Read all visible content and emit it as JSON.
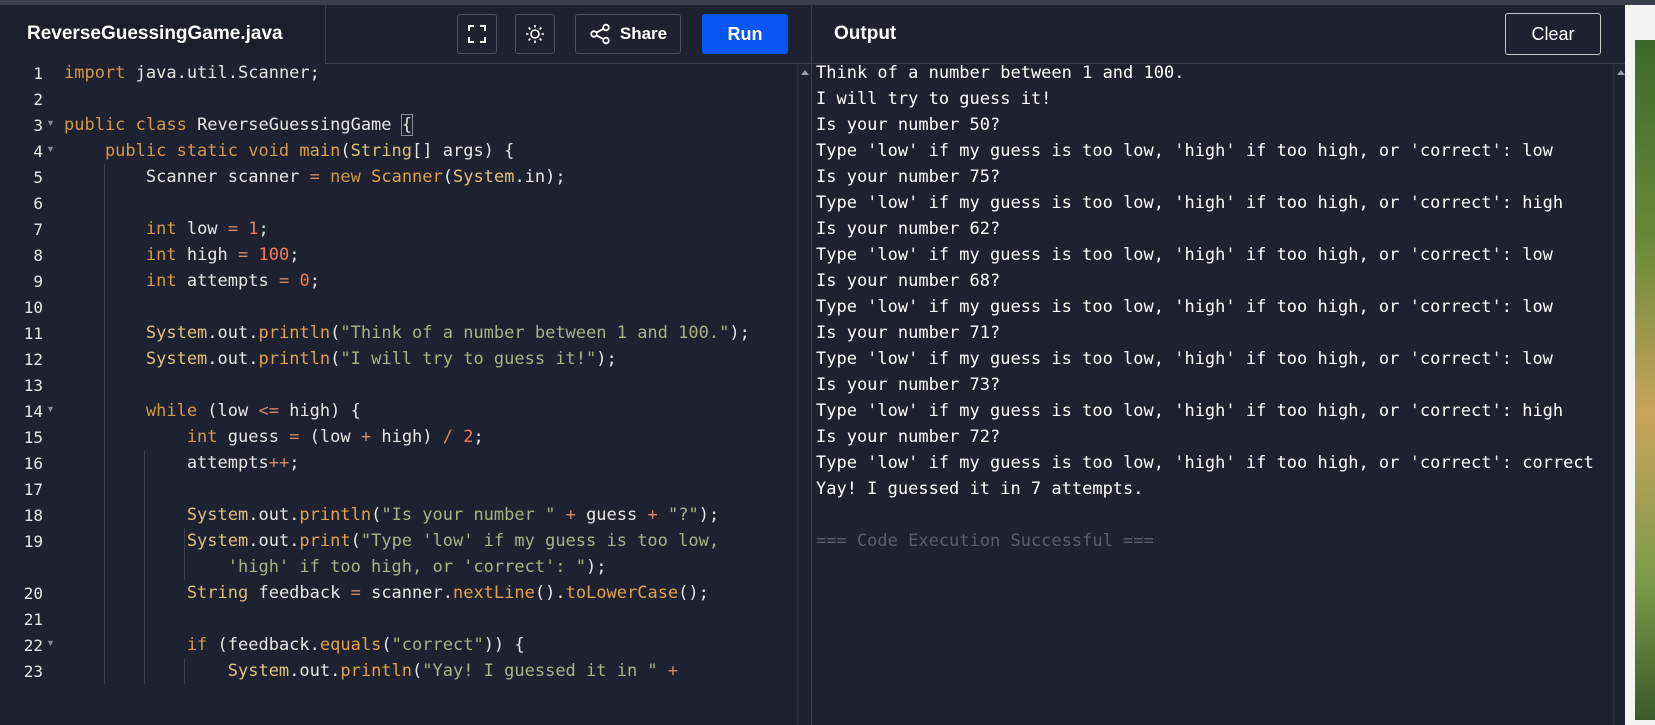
{
  "file_tab": {
    "name": "ReverseGuessingGame.java"
  },
  "toolbar": {
    "fullscreen_icon": "fullscreen-icon",
    "theme_icon": "sun-icon",
    "share_icon": "share-icon",
    "share_label": "Share",
    "run_label": "Run",
    "run_color": "#0556f3"
  },
  "output_panel": {
    "title": "Output",
    "clear_label": "Clear",
    "lines": [
      "Think of a number between 1 and 100.",
      "I will try to guess it!",
      "Is your number 50?",
      "Type 'low' if my guess is too low, 'high' if too high, or 'correct': low",
      "Is your number 75?",
      "Type 'low' if my guess is too low, 'high' if too high, or 'correct': high",
      "Is your number 62?",
      "Type 'low' if my guess is too low, 'high' if too high, or 'correct': low",
      "Is your number 68?",
      "Type 'low' if my guess is too low, 'high' if too high, or 'correct': low",
      "Is your number 71?",
      "Type 'low' if my guess is too low, 'high' if too high, or 'correct': low",
      "Is your number 73?",
      "Type 'low' if my guess is too low, 'high' if too high, or 'correct': high",
      "Is your number 72?",
      "Type 'low' if my guess is too low, 'high' if too high, or 'correct': correct",
      "Yay! I guessed it in 7 attempts."
    ],
    "status": "=== Code Execution Successful ==="
  },
  "editor": {
    "line_numbers": [
      "1",
      "2",
      "3",
      "4",
      "5",
      "6",
      "7",
      "8",
      "9",
      "10",
      "11",
      "12",
      "13",
      "14",
      "15",
      "16",
      "17",
      "18",
      "19",
      "",
      "20",
      "21",
      "22",
      "23"
    ],
    "lines": [
      [
        {
          "t": "import",
          "c": "kw"
        },
        {
          "t": " java.util.Scanner;",
          "c": ""
        }
      ],
      [],
      [
        {
          "t": "public class",
          "c": "kw"
        },
        {
          "t": " ReverseGuessingGame ",
          "c": ""
        },
        {
          "t": "{",
          "c": "bracket"
        }
      ],
      [
        {
          "t": "    public static void ",
          "c": "kw"
        },
        {
          "t": "main",
          "c": "fn"
        },
        {
          "t": "(",
          "c": ""
        },
        {
          "t": "String",
          "c": "ty"
        },
        {
          "t": "[] args) {",
          "c": ""
        }
      ],
      [
        {
          "t": "        Scanner scanner ",
          "c": ""
        },
        {
          "t": "=",
          "c": "op"
        },
        {
          "t": " ",
          "c": ""
        },
        {
          "t": "new",
          "c": "kw"
        },
        {
          "t": " ",
          "c": ""
        },
        {
          "t": "Scanner",
          "c": "fn"
        },
        {
          "t": "(",
          "c": ""
        },
        {
          "t": "System",
          "c": "cls"
        },
        {
          "t": ".in);",
          "c": ""
        }
      ],
      [],
      [
        {
          "t": "        int",
          "c": "kw"
        },
        {
          "t": " low ",
          "c": ""
        },
        {
          "t": "=",
          "c": "op"
        },
        {
          "t": " ",
          "c": ""
        },
        {
          "t": "1",
          "c": "num"
        },
        {
          "t": ";",
          "c": ""
        }
      ],
      [
        {
          "t": "        int",
          "c": "kw"
        },
        {
          "t": " high ",
          "c": ""
        },
        {
          "t": "=",
          "c": "op"
        },
        {
          "t": " ",
          "c": ""
        },
        {
          "t": "100",
          "c": "num"
        },
        {
          "t": ";",
          "c": ""
        }
      ],
      [
        {
          "t": "        int",
          "c": "kw"
        },
        {
          "t": " attempts ",
          "c": ""
        },
        {
          "t": "=",
          "c": "op"
        },
        {
          "t": " ",
          "c": ""
        },
        {
          "t": "0",
          "c": "num"
        },
        {
          "t": ";",
          "c": ""
        }
      ],
      [],
      [
        {
          "t": "        System",
          "c": "cls"
        },
        {
          "t": ".out.",
          "c": ""
        },
        {
          "t": "println",
          "c": "fn"
        },
        {
          "t": "(",
          "c": ""
        },
        {
          "t": "\"Think of a number between 1 and 100.\"",
          "c": "str"
        },
        {
          "t": ");",
          "c": ""
        }
      ],
      [
        {
          "t": "        System",
          "c": "cls"
        },
        {
          "t": ".out.",
          "c": ""
        },
        {
          "t": "println",
          "c": "fn"
        },
        {
          "t": "(",
          "c": ""
        },
        {
          "t": "\"I will try to guess it!\"",
          "c": "str"
        },
        {
          "t": ");",
          "c": ""
        }
      ],
      [],
      [
        {
          "t": "        while",
          "c": "kw"
        },
        {
          "t": " (low ",
          "c": ""
        },
        {
          "t": "<=",
          "c": "op"
        },
        {
          "t": " high) {",
          "c": ""
        }
      ],
      [
        {
          "t": "            int",
          "c": "kw"
        },
        {
          "t": " guess ",
          "c": ""
        },
        {
          "t": "=",
          "c": "op"
        },
        {
          "t": " (low ",
          "c": ""
        },
        {
          "t": "+",
          "c": "op"
        },
        {
          "t": " high) ",
          "c": ""
        },
        {
          "t": "/",
          "c": "op"
        },
        {
          "t": " ",
          "c": ""
        },
        {
          "t": "2",
          "c": "num"
        },
        {
          "t": ";",
          "c": ""
        }
      ],
      [
        {
          "t": "            attempts",
          "c": ""
        },
        {
          "t": "++",
          "c": "op"
        },
        {
          "t": ";",
          "c": ""
        }
      ],
      [],
      [
        {
          "t": "            System",
          "c": "cls"
        },
        {
          "t": ".out.",
          "c": ""
        },
        {
          "t": "println",
          "c": "fn"
        },
        {
          "t": "(",
          "c": ""
        },
        {
          "t": "\"Is your number \"",
          "c": "str"
        },
        {
          "t": " ",
          "c": ""
        },
        {
          "t": "+",
          "c": "op"
        },
        {
          "t": " guess ",
          "c": ""
        },
        {
          "t": "+",
          "c": "op"
        },
        {
          "t": " ",
          "c": ""
        },
        {
          "t": "\"?\"",
          "c": "str"
        },
        {
          "t": ");",
          "c": ""
        }
      ],
      [
        {
          "t": "            System",
          "c": "cls"
        },
        {
          "t": ".out.",
          "c": ""
        },
        {
          "t": "print",
          "c": "fn"
        },
        {
          "t": "(",
          "c": ""
        },
        {
          "t": "\"Type 'low' if my guess is too low,",
          "c": "str"
        }
      ],
      [
        {
          "t": "                'high' if too high, or 'correct': \"",
          "c": "str"
        },
        {
          "t": ");",
          "c": ""
        }
      ],
      [
        {
          "t": "            String",
          "c": "ty"
        },
        {
          "t": " feedback ",
          "c": ""
        },
        {
          "t": "=",
          "c": "op"
        },
        {
          "t": " scanner.",
          "c": ""
        },
        {
          "t": "nextLine",
          "c": "fn"
        },
        {
          "t": "().",
          "c": ""
        },
        {
          "t": "toLowerCase",
          "c": "fn"
        },
        {
          "t": "();",
          "c": ""
        }
      ],
      [],
      [
        {
          "t": "            if",
          "c": "kw"
        },
        {
          "t": " (feedback.",
          "c": ""
        },
        {
          "t": "equals",
          "c": "fn"
        },
        {
          "t": "(",
          "c": ""
        },
        {
          "t": "\"correct\"",
          "c": "str"
        },
        {
          "t": ")) {",
          "c": ""
        }
      ],
      [
        {
          "t": "                System",
          "c": "cls"
        },
        {
          "t": ".out.",
          "c": ""
        },
        {
          "t": "println",
          "c": "fn"
        },
        {
          "t": "(",
          "c": ""
        },
        {
          "t": "\"Yay! I guessed it in \"",
          "c": "str"
        },
        {
          "t": " ",
          "c": ""
        },
        {
          "t": "+",
          "c": "op"
        }
      ]
    ],
    "foldable_lines": [
      "3",
      "4",
      "14",
      "22"
    ]
  }
}
